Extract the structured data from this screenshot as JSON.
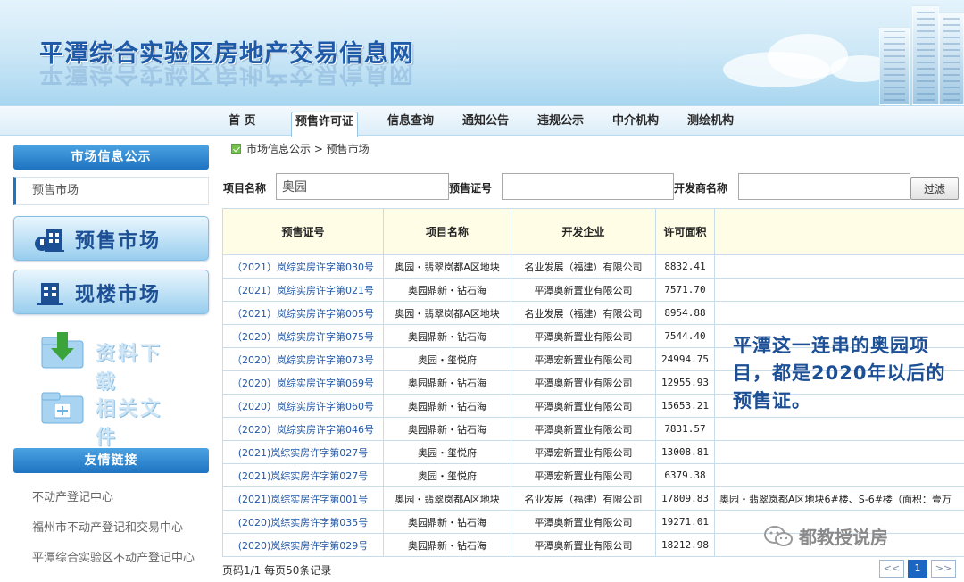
{
  "site": {
    "title": "平潭综合实验区房地产交易信息网"
  },
  "nav": {
    "items": [
      {
        "label": "首 页"
      },
      {
        "label": "预售许可证",
        "active": true
      },
      {
        "label": "信息查询"
      },
      {
        "label": "通知公告"
      },
      {
        "label": "违规公示"
      },
      {
        "label": "中介机构"
      },
      {
        "label": "测绘机构"
      }
    ]
  },
  "sidebar": {
    "market_header": "市场信息公示",
    "market_link": "预售市场",
    "presale_btn": "预售市场",
    "existing_btn": "现楼市场",
    "download_btn": "资料下载",
    "docs_btn": "相关文件",
    "friends_header": "友情链接",
    "friend_links": [
      "不动产登记中心",
      "福州市不动产登记和交易中心",
      "平潭综合实验区不动产登记中心"
    ]
  },
  "breadcrumb": {
    "text": "市场信息公示 > 预售市场"
  },
  "filter": {
    "project_label": "项目名称",
    "project_value": "奥园",
    "permit_label": "预售证号",
    "permit_value": "",
    "developer_label": "开发商名称",
    "developer_value": "",
    "button": "过滤"
  },
  "table": {
    "headers": [
      "预售证号",
      "项目名称",
      "开发企业",
      "许可面积",
      ""
    ],
    "rows": [
      {
        "permit": "（2021）岚综实房许字第030号",
        "project": "奥园・翡翠岚都A区地块",
        "developer": "名业发展（福建）有限公司",
        "area": "8832.41",
        "remark": ""
      },
      {
        "permit": "（2021）岚综实房许字第021号",
        "project": "奥园鼎新・钻石海",
        "developer": "平潭奥新置业有限公司",
        "area": "7571.70",
        "remark": ""
      },
      {
        "permit": "（2021）岚综实房许字第005号",
        "project": "奥园・翡翠岚都A区地块",
        "developer": "名业发展（福建）有限公司",
        "area": "8954.88",
        "remark": ""
      },
      {
        "permit": "（2020）岚综实房许字第075号",
        "project": "奥园鼎新・钻石海",
        "developer": "平潭奥新置业有限公司",
        "area": "7544.40",
        "remark": ""
      },
      {
        "permit": "（2020）岚综实房许字第073号",
        "project": "奥园・玺悦府",
        "developer": "平潭宏新置业有限公司",
        "area": "24994.75",
        "remark": ""
      },
      {
        "permit": "（2020）岚综实房许字第069号",
        "project": "奥园鼎新・钻石海",
        "developer": "平潭奥新置业有限公司",
        "area": "12955.93",
        "remark": ""
      },
      {
        "permit": "（2020）岚综实房许字第060号",
        "project": "奥园鼎新・钻石海",
        "developer": "平潭奥新置业有限公司",
        "area": "15653.21",
        "remark": ""
      },
      {
        "permit": "（2020）岚综实房许字第046号",
        "project": "奥园鼎新・钻石海",
        "developer": "平潭奥新置业有限公司",
        "area": "7831.57",
        "remark": ""
      },
      {
        "permit": "(2021)岚综实房许字第027号",
        "project": "奥园・玺悦府",
        "developer": "平潭宏新置业有限公司",
        "area": "13008.81",
        "remark": ""
      },
      {
        "permit": "(2021)岚综实房许字第027号",
        "project": "奥园・玺悦府",
        "developer": "平潭宏新置业有限公司",
        "area": "6379.38",
        "remark": ""
      },
      {
        "permit": "(2021)岚综实房许字第001号",
        "project": "奥园・翡翠岚都A区地块",
        "developer": "名业发展（福建）有限公司",
        "area": "17809.83",
        "remark": "奥园・翡翠岚都A区地块6#楼、S-6#楼（面积：壹万"
      },
      {
        "permit": "(2020)岚综实房许字第035号",
        "project": "奥园鼎新・钻石海",
        "developer": "平潭奥新置业有限公司",
        "area": "19271.01",
        "remark": ""
      },
      {
        "permit": "(2020)岚综实房许字第029号",
        "project": "奥园鼎新・钻石海",
        "developer": "平潭奥新置业有限公司",
        "area": "18212.98",
        "remark": ""
      }
    ]
  },
  "pager": {
    "text": "页码1/1 每页50条记录",
    "prev": "<<",
    "current": "1",
    "next": ">>"
  },
  "overlay": {
    "note": "平潭这一连串的奥园项目，都是2020年以后的预售证。"
  },
  "watermark": {
    "text": "都教授说房"
  },
  "colors": {
    "brand_blue": "#1f73c1",
    "link_blue": "#2358a6",
    "header_yellow": "#fffde5",
    "note_blue": "#1d4f95"
  },
  "icons": [
    "building-icon",
    "folder-download-icon",
    "folder-docs-icon",
    "check-icon",
    "wechat-icon"
  ]
}
